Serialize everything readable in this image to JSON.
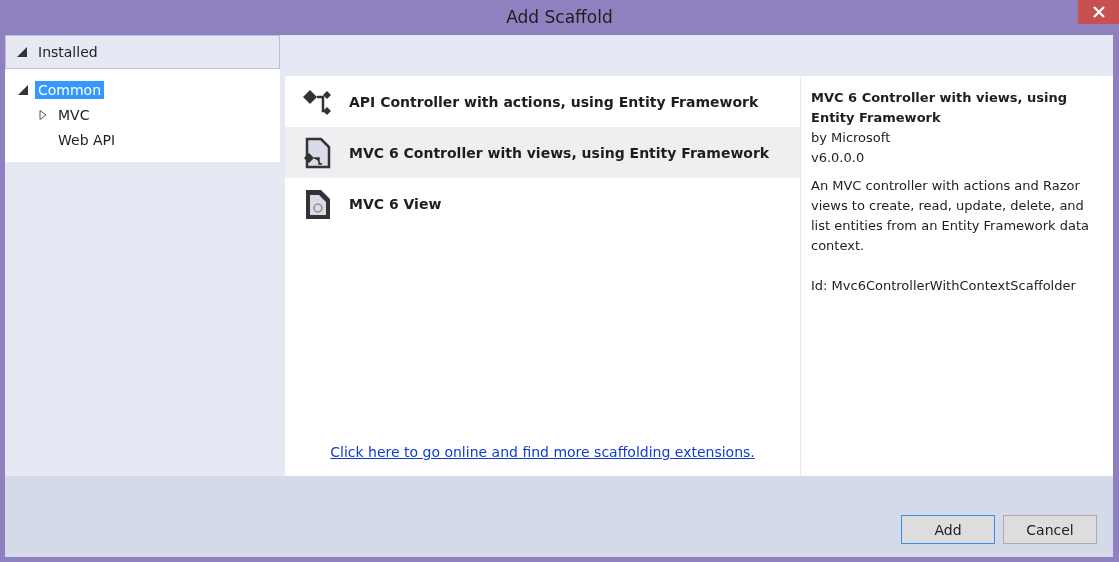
{
  "window": {
    "title": "Add Scaffold"
  },
  "category_header": {
    "label": "Installed",
    "expanded": true
  },
  "tree": [
    {
      "label": "Common",
      "expanded": true,
      "selected": true,
      "children": [
        {
          "label": "MVC",
          "expanded": false,
          "selected": false
        },
        {
          "label": "Web API",
          "selected": false
        }
      ]
    }
  ],
  "scaffolds": [
    {
      "kind": "api",
      "label": "API Controller with actions, using Entity Framework",
      "selected": false
    },
    {
      "kind": "controller",
      "label": "MVC 6 Controller with views, using Entity Framework",
      "selected": true
    },
    {
      "kind": "view",
      "label": "MVC 6 View",
      "selected": false
    }
  ],
  "online_link": "Click here to go online and find more scaffolding extensions.",
  "details": {
    "title": "MVC 6 Controller with views, using Entity Framework",
    "author": "by Microsoft",
    "version": "v6.0.0.0",
    "description": "An MVC controller with actions and Razor views to create, read, update, delete, and list entities from an Entity Framework data context.",
    "id": "Id: Mvc6ControllerWithContextScaffolder"
  },
  "buttons": [
    {
      "label": "Add",
      "default": true
    },
    {
      "label": "Cancel",
      "default": false
    }
  ]
}
